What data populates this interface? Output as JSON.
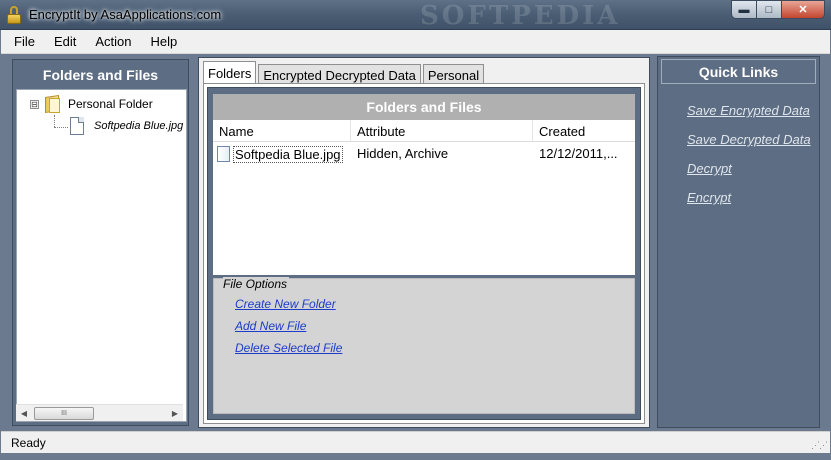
{
  "window": {
    "title": "EncryptIt by AsaApplications.com",
    "watermark": "SOFTPEDIA",
    "min_symbol": "▬",
    "max_symbol": "□",
    "close_symbol": "✕"
  },
  "menu": [
    "File",
    "Edit",
    "Action",
    "Help"
  ],
  "left_panel": {
    "title": "Folders and Files",
    "tree": {
      "expander": "⊟",
      "root": "Personal Folder",
      "child": "Softpedia Blue.jpg"
    },
    "scroll_thumb": "III"
  },
  "tabs": [
    "Folders",
    "Encrypted Decrypted Data",
    "Personal"
  ],
  "files": {
    "title": "Folders and Files",
    "columns": [
      "Name",
      "Attribute",
      "Created"
    ],
    "rows": [
      {
        "name": "Softpedia Blue.jpg",
        "attribute": "Hidden, Archive",
        "created": "12/12/2011,..."
      }
    ]
  },
  "file_options": {
    "legend": "File Options",
    "links": [
      "Create New Folder",
      "Add New File",
      "Delete Selected File"
    ]
  },
  "quick_links": {
    "title": "Quick Links",
    "links": [
      "Save Encrypted Data",
      "Save Decrypted Data",
      "Decrypt",
      "Encrypt"
    ]
  },
  "status": "Ready",
  "colors": {
    "panel": "#5d6d83",
    "link_blue": "#1d3cc9",
    "quick_link": "#dfe5ec"
  }
}
